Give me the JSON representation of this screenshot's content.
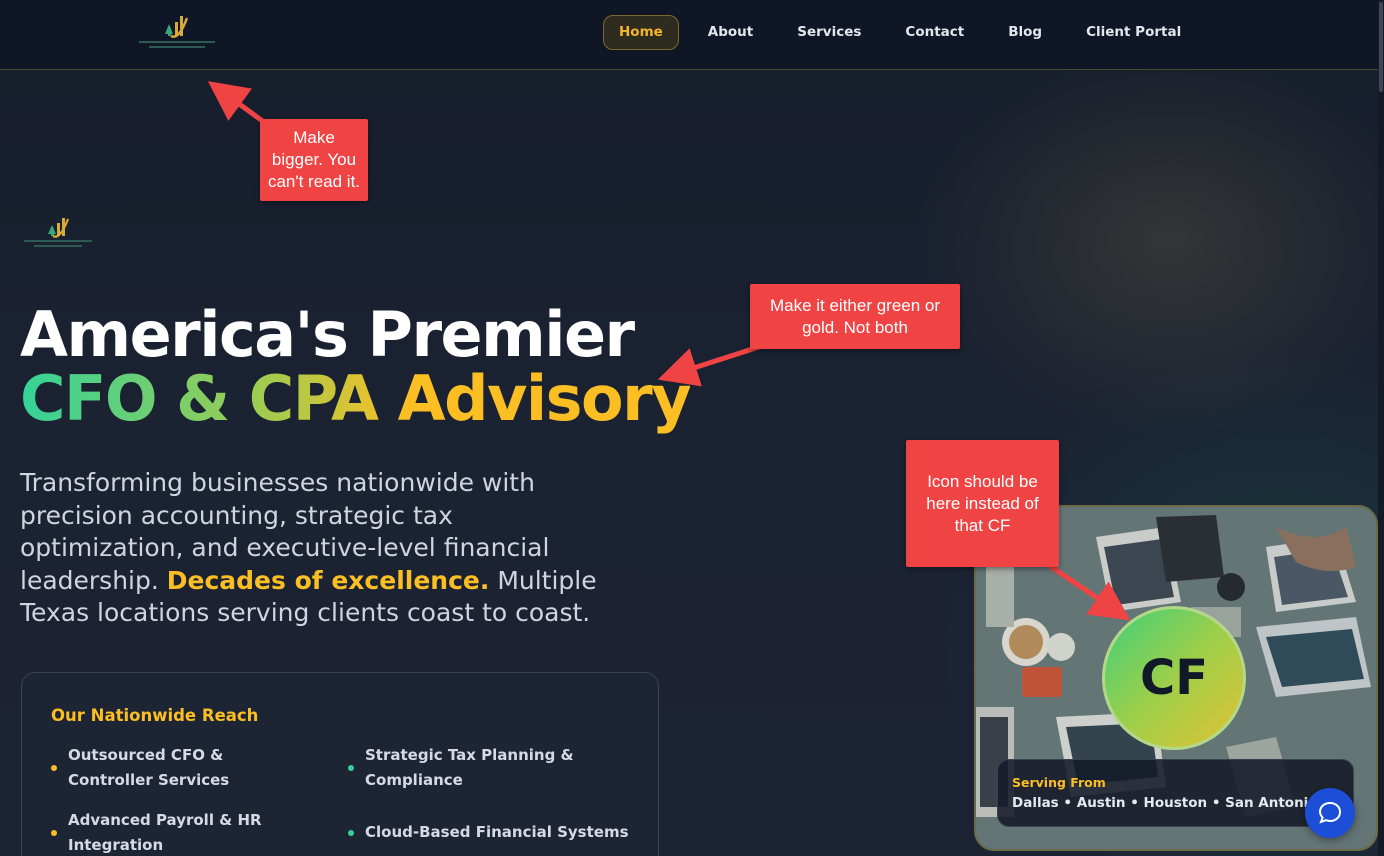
{
  "colors": {
    "accent_gold": "#fbbf24",
    "accent_green": "#34d399",
    "annotation_red": "#f04444",
    "nav_bg": "#0f1625",
    "chat_blue": "#1d4ed8"
  },
  "nav": {
    "logo_icon": "finance-growth-logo-icon",
    "items": [
      {
        "label": "Home",
        "active": true
      },
      {
        "label": "About"
      },
      {
        "label": "Services"
      },
      {
        "label": "Contact"
      },
      {
        "label": "Blog"
      },
      {
        "label": "Client Portal"
      }
    ]
  },
  "hero": {
    "headline_line1": "America's Premier",
    "headline_line2": "CFO & CPA Advisory",
    "subtext_part1": "Transforming businesses nationwide with precision accounting, strategic tax optimization, and executive-level financial leadership. ",
    "subtext_highlight": "Decades of excellence.",
    "subtext_part2": " Multiple Texas locations serving clients coast to coast."
  },
  "reach": {
    "title": "Our Nationwide Reach",
    "items": [
      {
        "label": "Outsourced CFO & Controller Services",
        "dot": "#fbbf24"
      },
      {
        "label": "Strategic Tax Planning & Compliance",
        "dot": "#34d399"
      },
      {
        "label": "Advanced Payroll & HR Integration",
        "dot": "#fbbf24"
      },
      {
        "label": "Cloud-Based Financial Systems",
        "dot": "#34d399"
      }
    ]
  },
  "visual_card": {
    "badge_text": "CF",
    "serving_label": "Serving From",
    "serving_cities": "Dallas • Austin • Houston • San Antonio"
  },
  "chat": {
    "icon": "chat-bubble-icon"
  },
  "annotations": {
    "note1": "Make bigger. You can't read it.",
    "note2": "Make it either green or gold. Not both",
    "note3": "Icon should be here instead of that CF"
  }
}
